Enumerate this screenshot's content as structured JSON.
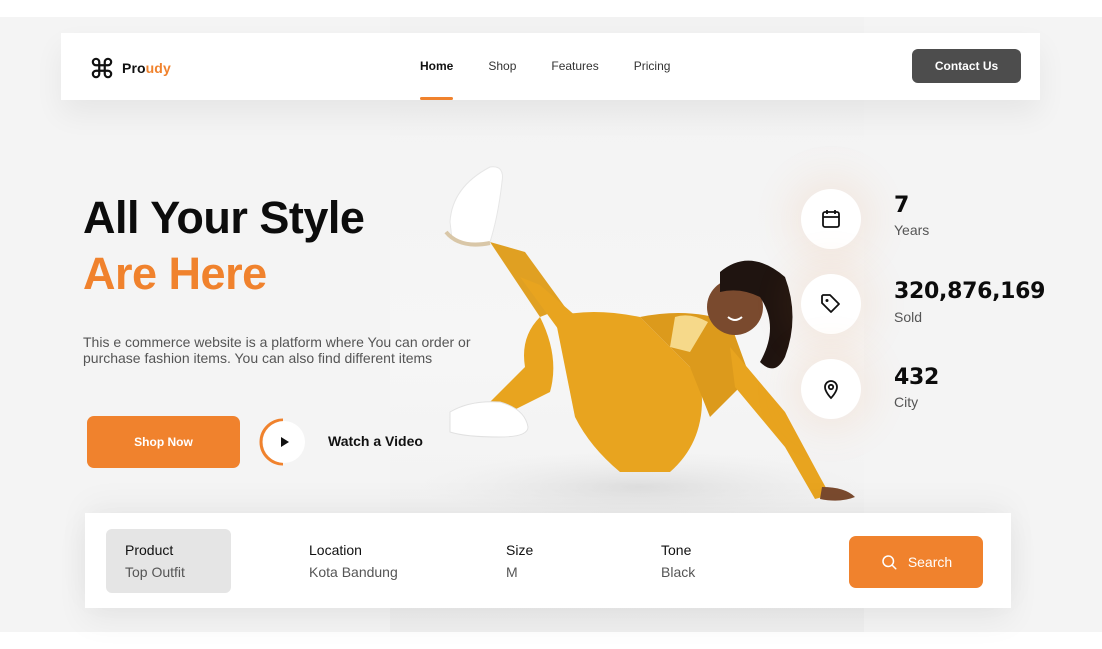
{
  "brand": {
    "name_dark": "Pro",
    "name_accent": "udy"
  },
  "nav": {
    "items": [
      {
        "label": "Home",
        "active": true
      },
      {
        "label": "Shop",
        "active": false
      },
      {
        "label": "Features",
        "active": false
      },
      {
        "label": "Pricing",
        "active": false
      }
    ],
    "contact_label": "Contact Us"
  },
  "hero": {
    "headline_line1": "All Your Style",
    "headline_line2": "Are Here",
    "description": "This e commerce website is a platform where You can order or purchase fashion items. You can also find different items",
    "shop_label": "Shop Now",
    "watch_label": "Watch a Video"
  },
  "stats": [
    {
      "value": "7",
      "label": "Years",
      "icon": "calendar-icon"
    },
    {
      "value": "320,876,169",
      "label": "Sold",
      "icon": "tag-icon"
    },
    {
      "value": "432",
      "label": "City",
      "icon": "location-pin-icon"
    }
  ],
  "search": {
    "fields": [
      {
        "label": "Product",
        "value": "Top Outfit",
        "active": true
      },
      {
        "label": "Location",
        "value": "Kota Bandung",
        "active": false
      },
      {
        "label": "Size",
        "value": "M",
        "active": false
      },
      {
        "label": "Tone",
        "value": "Black",
        "active": false
      }
    ],
    "button_label": "Search"
  },
  "colors": {
    "accent": "#f0822d",
    "dark_button": "#4d4d4d",
    "outfit_yellow": "#e8a41f"
  }
}
